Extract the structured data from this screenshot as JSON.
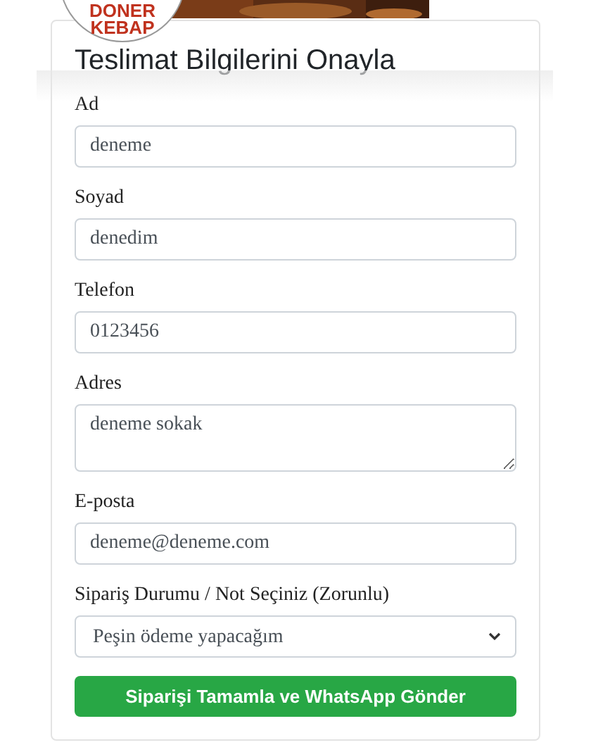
{
  "logo": {
    "lines": [
      "DONER",
      "KEBAP"
    ]
  },
  "title": "Teslimat Bilgilerini Onayla",
  "fields": [
    {
      "kind": "input",
      "label": "Ad",
      "value": "deneme"
    },
    {
      "kind": "input",
      "label": "Soyad",
      "value": "denedim"
    },
    {
      "kind": "input",
      "label": "Telefon",
      "value": "0123456"
    },
    {
      "kind": "textarea",
      "label": "Adres",
      "value": "deneme sokak"
    },
    {
      "kind": "input",
      "label": "E-posta",
      "value": "deneme@deneme.com"
    },
    {
      "kind": "select",
      "label": "Sipariş Durumu / Not Seçiniz (Zorunlu)",
      "value": "Peşin ödeme yapacağım"
    }
  ],
  "submit": "Siparişi Tamamla ve WhatsApp Gönder"
}
